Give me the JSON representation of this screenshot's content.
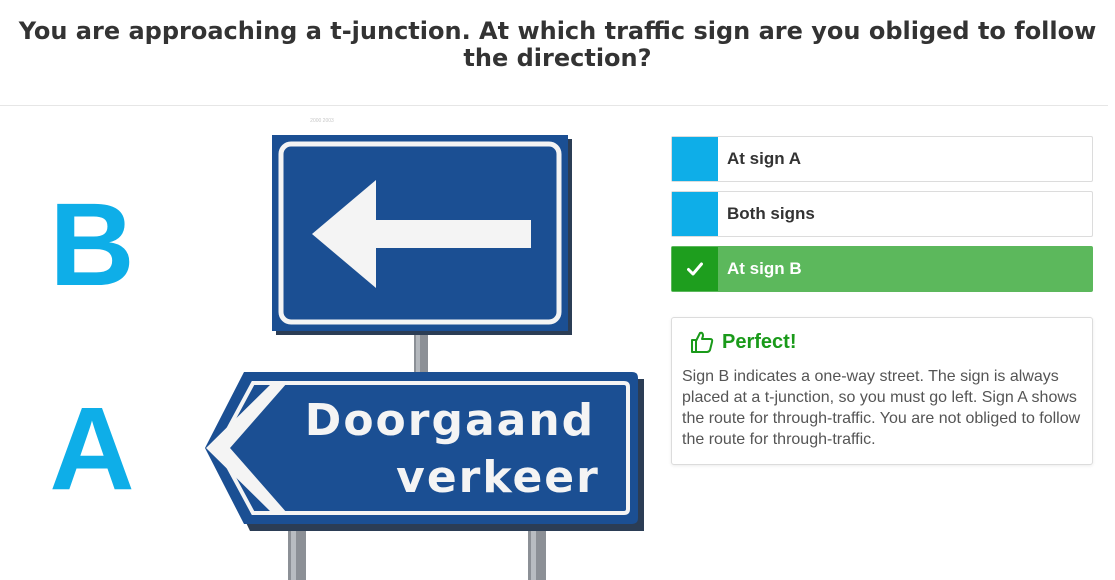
{
  "question": "You are approaching a t-junction. At which traffic sign are you obliged to follow the direction?",
  "image": {
    "label_b": "B",
    "label_a": "A",
    "sign_a_line1": "Doorgaand",
    "sign_a_line2": "verkeer",
    "copyright": "2000 2003"
  },
  "answers": [
    {
      "label": "At sign A",
      "state": "unselected"
    },
    {
      "label": "Both signs",
      "state": "unselected"
    },
    {
      "label": "At sign B",
      "state": "correct"
    }
  ],
  "feedback": {
    "title": "Perfect!",
    "text": "Sign B indicates a one-way street. The sign is always placed at a t-junction, so you must go left. Sign A shows the route for through-traffic. You are not obliged to follow the route for through-traffic.",
    "icon": "thumbs-up-icon"
  },
  "colors": {
    "accent": "#0eaee8",
    "correct": "#5cb85c",
    "correct_dark": "#1e9e1e",
    "sign_blue": "#1b4f93"
  }
}
